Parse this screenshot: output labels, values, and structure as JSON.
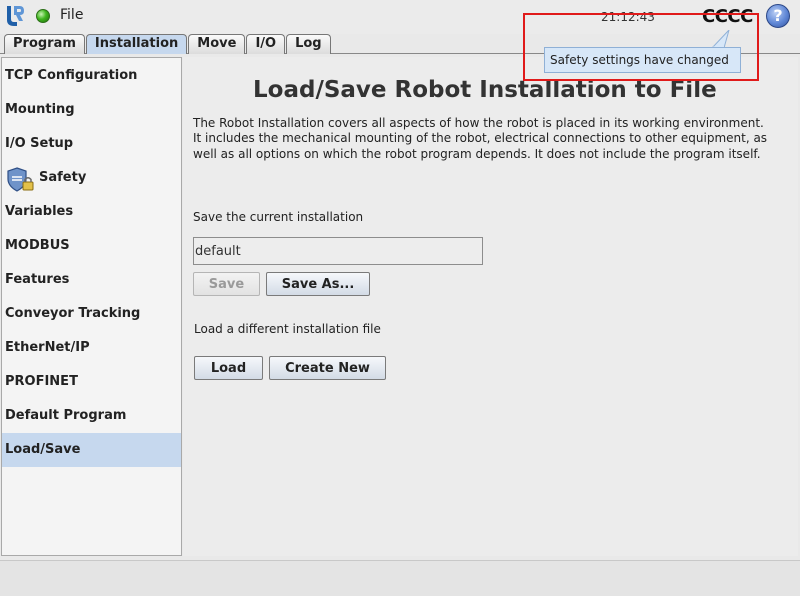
{
  "header": {
    "file_menu": "File",
    "clock": "21:12:43",
    "indicator": "CCCC",
    "help": "?"
  },
  "tabs": [
    {
      "label": "Program"
    },
    {
      "label": "Installation",
      "active": true
    },
    {
      "label": "Move"
    },
    {
      "label": "I/O"
    },
    {
      "label": "Log"
    }
  ],
  "sidebar": {
    "items": [
      {
        "label": "TCP Configuration"
      },
      {
        "label": "Mounting"
      },
      {
        "label": "I/O Setup"
      },
      {
        "label": "Safety",
        "icon": "safety-shield-lock-icon"
      },
      {
        "label": "Variables"
      },
      {
        "label": "MODBUS"
      },
      {
        "label": "Features"
      },
      {
        "label": "Conveyor Tracking"
      },
      {
        "label": "EtherNet/IP"
      },
      {
        "label": "PROFINET"
      },
      {
        "label": "Default Program"
      },
      {
        "label": "Load/Save",
        "active": true
      }
    ]
  },
  "main": {
    "title": "Load/Save Robot Installation to File",
    "description": "The Robot Installation covers all aspects of how the robot is placed in its working environment. It includes the mechanical mounting of the robot, electrical connections to other equipment, as well as all options on which the robot program depends. It does not include the program itself.",
    "save_section_label": "Save the current installation",
    "installation_name": "default",
    "save_button": "Save",
    "save_as_button": "Save As...",
    "load_section_label": "Load a different installation file",
    "load_button": "Load",
    "create_new_button": "Create New"
  },
  "tooltip": {
    "text": "Safety settings have changed"
  },
  "colors": {
    "tab_active": "#c6d8ee",
    "highlight_border": "#e01a1a",
    "tooltip_bg": "#d7e7f8"
  }
}
